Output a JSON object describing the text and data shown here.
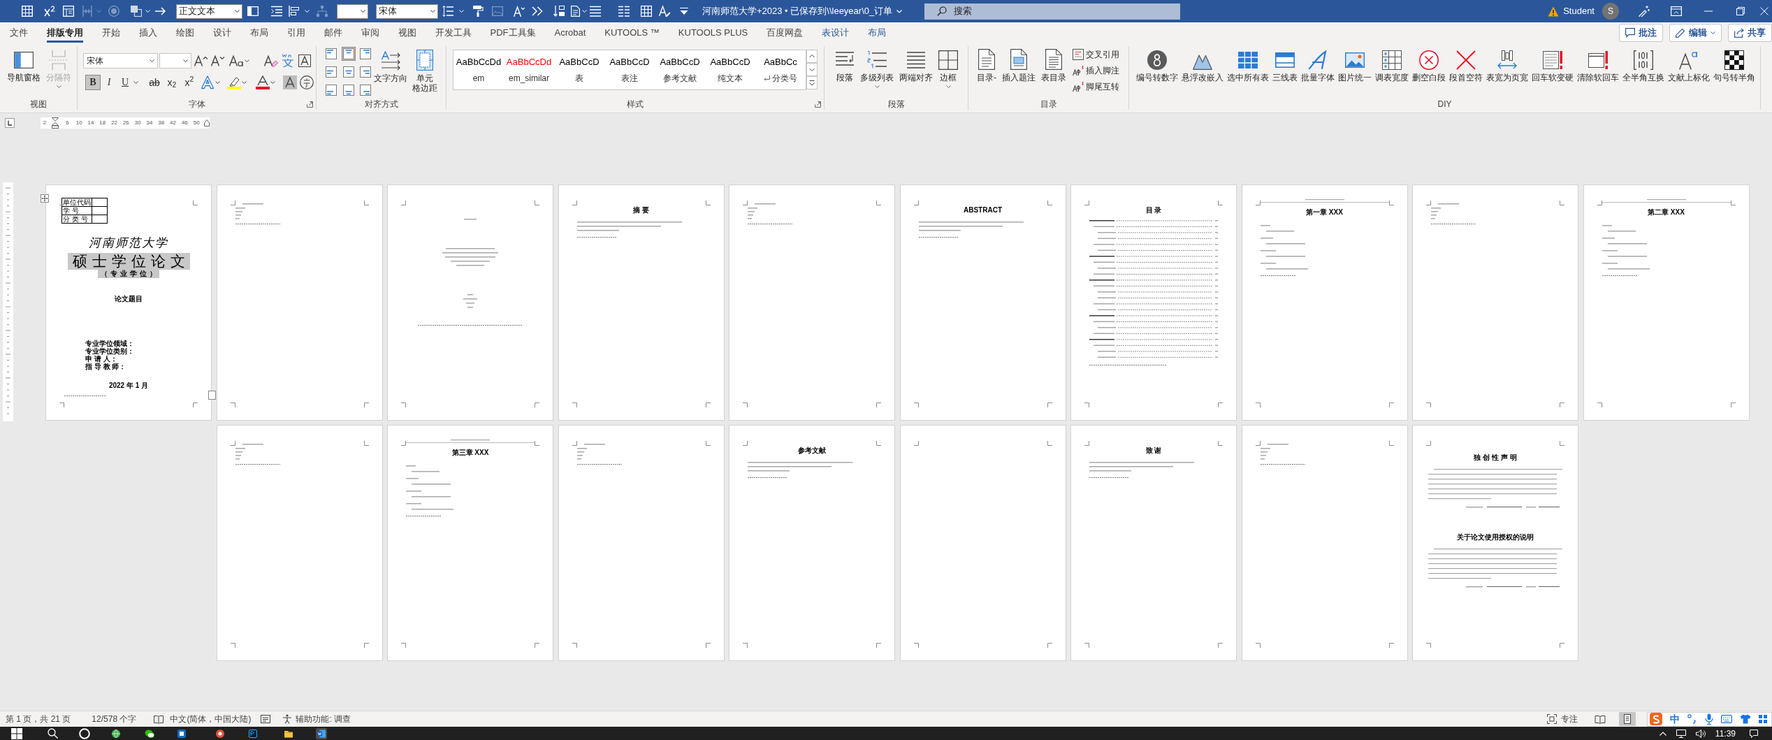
{
  "title_bar": {
    "quick_access": [
      {
        "kind": "icon",
        "disabled": false
      },
      {
        "kind": "icon",
        "disabled": false
      },
      {
        "kind": "icon",
        "disabled": false
      },
      {
        "kind": "icon",
        "disabled": true
      },
      {
        "kind": "icon",
        "disabled": true
      },
      {
        "kind": "icon",
        "disabled": false
      },
      {
        "kind": "icon",
        "disabled": false
      },
      {
        "kind": "dropdown",
        "value": "正文文本"
      },
      {
        "kind": "icon",
        "disabled": false
      },
      {
        "kind": "icon",
        "disabled": false
      },
      {
        "kind": "icon",
        "disabled": false
      },
      {
        "kind": "icon",
        "disabled": true
      },
      {
        "kind": "dropdown"
      },
      {
        "kind": "dropdown",
        "value": "宋体"
      },
      {
        "kind": "icon",
        "disabled": false
      },
      {
        "kind": "icon",
        "disabled": false
      },
      {
        "kind": "icon",
        "disabled": true
      },
      {
        "kind": "icon",
        "disabled": false
      },
      {
        "kind": "icon",
        "disabled": false
      },
      {
        "kind": "icon",
        "disabled": false
      },
      {
        "kind": "icon",
        "disabled": false
      },
      {
        "kind": "icon",
        "disabled": false
      },
      {
        "kind": "icon",
        "disabled": false
      },
      {
        "kind": "icon",
        "disabled": false
      },
      {
        "kind": "icon",
        "disabled": false
      },
      {
        "kind": "icon",
        "disabled": false
      }
    ],
    "document_title": "河南师范大学+2023 • 已保存到\\\\leeyear\\0_订单",
    "search": {
      "placeholder": "搜索"
    },
    "user": {
      "name": "Student",
      "initial": "S"
    }
  },
  "tabs": [
    {
      "label": "文件",
      "selected": false,
      "contextual": false
    },
    {
      "label": "排版专用",
      "selected": true,
      "contextual": false
    },
    {
      "label": "开始",
      "selected": false,
      "contextual": false
    },
    {
      "label": "插入",
      "selected": false,
      "contextual": false
    },
    {
      "label": "绘图",
      "selected": false,
      "contextual": false
    },
    {
      "label": "设计",
      "selected": false,
      "contextual": false
    },
    {
      "label": "布局",
      "selected": false,
      "contextual": false
    },
    {
      "label": "引用",
      "selected": false,
      "contextual": false
    },
    {
      "label": "邮件",
      "selected": false,
      "contextual": false
    },
    {
      "label": "审阅",
      "selected": false,
      "contextual": false
    },
    {
      "label": "视图",
      "selected": false,
      "contextual": false
    },
    {
      "label": "开发工具",
      "selected": false,
      "contextual": false
    },
    {
      "label": "PDF工具集",
      "selected": false,
      "contextual": false
    },
    {
      "label": "Acrobat",
      "selected": false,
      "contextual": false
    },
    {
      "label": "KUTOOLS ™",
      "selected": false,
      "contextual": false
    },
    {
      "label": "KUTOOLS PLUS",
      "selected": false,
      "contextual": false
    },
    {
      "label": "百度网盘",
      "selected": false,
      "contextual": false
    },
    {
      "label": "表设计",
      "selected": false,
      "contextual": true
    },
    {
      "label": "布局",
      "selected": false,
      "contextual": true
    }
  ],
  "tab_actions": [
    {
      "label": "批注",
      "dropdown": false
    },
    {
      "label": "编辑",
      "dropdown": true
    },
    {
      "label": "共享",
      "dropdown": false
    }
  ],
  "ribbon": {
    "view_group": {
      "label": "视图",
      "buttons": [
        {
          "label": "导航窗格",
          "disabled": false,
          "dropdown": false
        },
        {
          "label": "分隔符",
          "disabled": true,
          "dropdown": true
        }
      ]
    },
    "font_group": {
      "label": "字体",
      "font_name": "宋体",
      "format_buttons": [
        {
          "kind": "bold",
          "label": "B",
          "selected": true
        },
        {
          "kind": "italic",
          "label": "I",
          "selected": false
        },
        {
          "kind": "underline",
          "label": "U",
          "selected": false
        },
        {
          "kind": "strike",
          "label": "ab",
          "selected": false
        },
        {
          "kind": "subscript",
          "label": "x$_{2}$",
          "selected": false
        },
        {
          "kind": "superscript",
          "label": "x$^{2}$",
          "selected": false
        }
      ]
    },
    "alignment_group": {
      "label": "对齐方式",
      "cells": [
        {
          "selected": false
        },
        {
          "selected": true
        },
        {
          "selected": false
        },
        {
          "selected": false
        },
        {
          "selected": false
        },
        {
          "selected": false
        },
        {
          "selected": false
        },
        {
          "selected": false
        },
        {
          "selected": false
        }
      ],
      "buttons": [
        {
          "lines": [
            "文字方向"
          ]
        },
        {
          "lines": [
            "单元",
            "格边距"
          ]
        }
      ]
    },
    "styles_group": {
      "label": "样式",
      "styles": [
        {
          "preview": "AaBbCcDd",
          "name": "em",
          "color": "#000000",
          "paragraph_mark": false
        },
        {
          "preview": "AaBbCcDd",
          "name": "em_similar",
          "color": "#ff0000",
          "paragraph_mark": false
        },
        {
          "preview": "AaBbCcD",
          "name": "表",
          "color": "#000000",
          "paragraph_mark": false
        },
        {
          "preview": "AaBbCcD",
          "name": "表注",
          "color": "#000000",
          "paragraph_mark": false
        },
        {
          "preview": "AaBbCcD",
          "name": "参考文献",
          "color": "#000000",
          "paragraph_mark": false
        },
        {
          "preview": "AaBbCcD",
          "name": "纯文本",
          "color": "#000000",
          "paragraph_mark": false
        },
        {
          "preview": "AaBbCc",
          "name": "分类号",
          "color": "#000000",
          "paragraph_mark": true
        }
      ]
    },
    "paragraph_group": {
      "label": "段落",
      "buttons": [
        {
          "label": "段落",
          "dropdown": false
        },
        {
          "label": "多级列表",
          "dropdown": true
        },
        {
          "label": "两端对齐",
          "dropdown": false
        },
        {
          "label": "边框",
          "dropdown": true
        }
      ]
    },
    "toc_group": {
      "label": "目录",
      "buttons": [
        {
          "label": "目录-"
        },
        {
          "label": "插入题注"
        },
        {
          "label": "表目录"
        }
      ],
      "small_buttons": [
        {
          "label": "交叉引用"
        },
        {
          "label": "插入脚注"
        },
        {
          "label": "脚尾互转"
        }
      ]
    },
    "diy_group": {
      "label": "DIY",
      "buttons": [
        {
          "label": "编号转数字"
        },
        {
          "label": "悬浮改嵌入"
        },
        {
          "label": "选中所有表"
        },
        {
          "label": "三线表"
        },
        {
          "label": "批量字体"
        },
        {
          "label": "图片统一"
        },
        {
          "label": "调表宽度"
        },
        {
          "label": "删空白段"
        },
        {
          "label": "段首空符"
        },
        {
          "label": "表宽为页宽"
        },
        {
          "label": "回车软变硬"
        },
        {
          "label": "清除软回车"
        },
        {
          "label": "全半角互换"
        },
        {
          "label": "文献上标化"
        },
        {
          "label": "句号转半角"
        }
      ]
    }
  },
  "ruler": {
    "numbers": [
      "2",
      "6",
      "10",
      "14",
      "18",
      "22",
      "26",
      "30",
      "34",
      "38",
      "42",
      "46",
      "50"
    ]
  },
  "pages": [
    [
      {
        "kind": "cover",
        "id_table": [
          "单位代码",
          "学 号",
          "分 类 号"
        ],
        "university": "河南师范大学",
        "degree": "硕士学位论文",
        "degree_type": "（专业学位）",
        "thesis_title": "论文题目",
        "fields": [
          "专业学位领域：",
          "专业学位类别：",
          "申 请 人：",
          "指 导 教 师："
        ],
        "date": "2022 年 1 月"
      },
      {
        "kind": "notes"
      },
      {
        "kind": "title_page"
      },
      {
        "kind": "section",
        "heading": "摘 要"
      },
      {
        "kind": "notes"
      },
      {
        "kind": "section",
        "heading": "ABSTRACT"
      },
      {
        "kind": "toc",
        "heading": "目 录"
      },
      {
        "kind": "chapter",
        "heading": "第一章 XXX"
      },
      {
        "kind": "notes"
      },
      {
        "kind": "chapter",
        "heading": "第二章 XXX"
      }
    ],
    [
      {
        "kind": "notes"
      },
      {
        "kind": "chapter",
        "heading": "第三章 XXX"
      },
      {
        "kind": "notes"
      },
      {
        "kind": "section",
        "heading": "参考文献"
      },
      {
        "kind": "blank"
      },
      {
        "kind": "section",
        "heading": "致 谢"
      },
      {
        "kind": "notes"
      },
      {
        "kind": "statement",
        "headings": [
          "独 创 性 声 明",
          "关于论文使用授权的说明"
        ]
      }
    ]
  ],
  "status_bar": {
    "page_info": "第 1 页，共 21 页",
    "word_count": "12/578 个字",
    "language": "中文(简体，中国大陆)",
    "accessibility": "辅助功能: 调查",
    "focus": "专注",
    "views": [
      {
        "selected": false
      },
      {
        "selected": true
      }
    ]
  },
  "input_method": {
    "mode": "中"
  },
  "taskbar": {
    "apps": [
      {
        "active": false
      },
      {
        "active": false
      },
      {
        "active": false
      },
      {
        "active": false
      },
      {
        "active": false
      },
      {
        "active": false
      },
      {
        "active": true
      }
    ],
    "time": "11:39"
  }
}
